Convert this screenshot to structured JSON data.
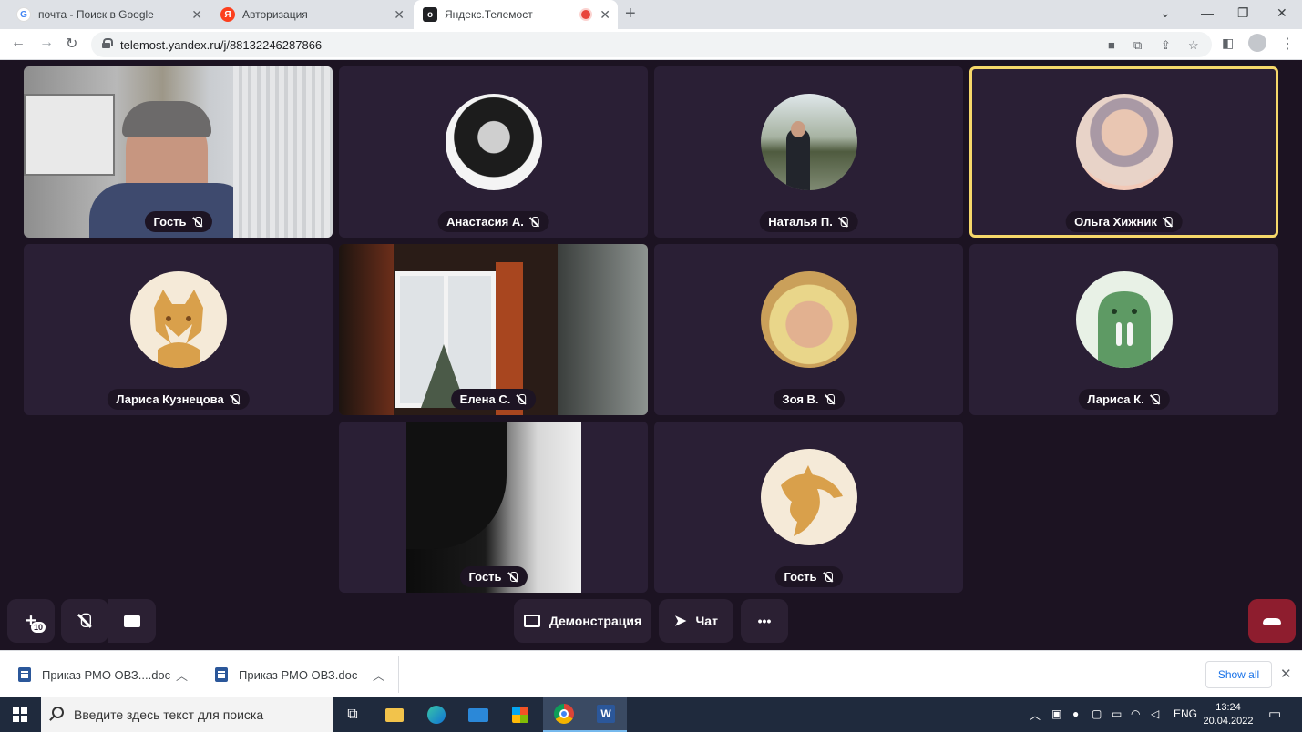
{
  "browser": {
    "tabs": [
      {
        "title": "почта - Поиск в Google",
        "favicon": "google-icon",
        "color": "#4285f4"
      },
      {
        "title": "Авторизация",
        "favicon": "yandex-icon",
        "color": "#fc3f1d"
      },
      {
        "title": "Яндекс.Телемост",
        "favicon": "telemost-icon",
        "color": "#202124",
        "active": true,
        "recording": true
      }
    ],
    "url": "telemost.yandex.ru/j/88132246287866"
  },
  "participants": [
    {
      "name": "Гость",
      "muted": true,
      "kind": "video"
    },
    {
      "name": "Анастасия А.",
      "muted": true,
      "kind": "avatar-photo"
    },
    {
      "name": "Наталья П.",
      "muted": true,
      "kind": "avatar-photo"
    },
    {
      "name": "Ольга Хижник",
      "muted": true,
      "kind": "avatar-photo",
      "speaking": true
    },
    {
      "name": "Лариса Кузнецова",
      "muted": true,
      "kind": "avatar-fox"
    },
    {
      "name": "Елена С.",
      "muted": true,
      "kind": "video"
    },
    {
      "name": "Зоя В.",
      "muted": true,
      "kind": "avatar-photo"
    },
    {
      "name": "Лариса К.",
      "muted": true,
      "kind": "avatar-walrus"
    },
    {
      "name": "Гость",
      "muted": true,
      "kind": "video"
    },
    {
      "name": "Гость",
      "muted": true,
      "kind": "avatar-dolphin"
    }
  ],
  "controls": {
    "participant_count": "10",
    "demo_label": "Демонстрация",
    "chat_label": "Чат",
    "more_label": "•••"
  },
  "downloads": {
    "items": [
      {
        "name": "Приказ РМО ОВЗ....doc"
      },
      {
        "name": "Приказ РМО ОВЗ.doc"
      }
    ],
    "show_all": "Show all"
  },
  "taskbar": {
    "search_placeholder": "Введите здесь текст для поиска",
    "lang": "ENG",
    "time": "13:24",
    "date": "20.04.2022"
  },
  "colors": {
    "background": "#1c1322",
    "tile": "#2a1f35",
    "active_speaker_border": "#f6d86a",
    "hangup": "#8e1d2e",
    "avatar_fox_bg": "#f5ead8",
    "avatar_fox": "#d9a04b",
    "avatar_walrus_bg": "#e8f1e6",
    "avatar_walrus": "#5e9a64",
    "avatar_dolphin_bg": "#f5ead8",
    "avatar_dolphin": "#d9a04b"
  }
}
